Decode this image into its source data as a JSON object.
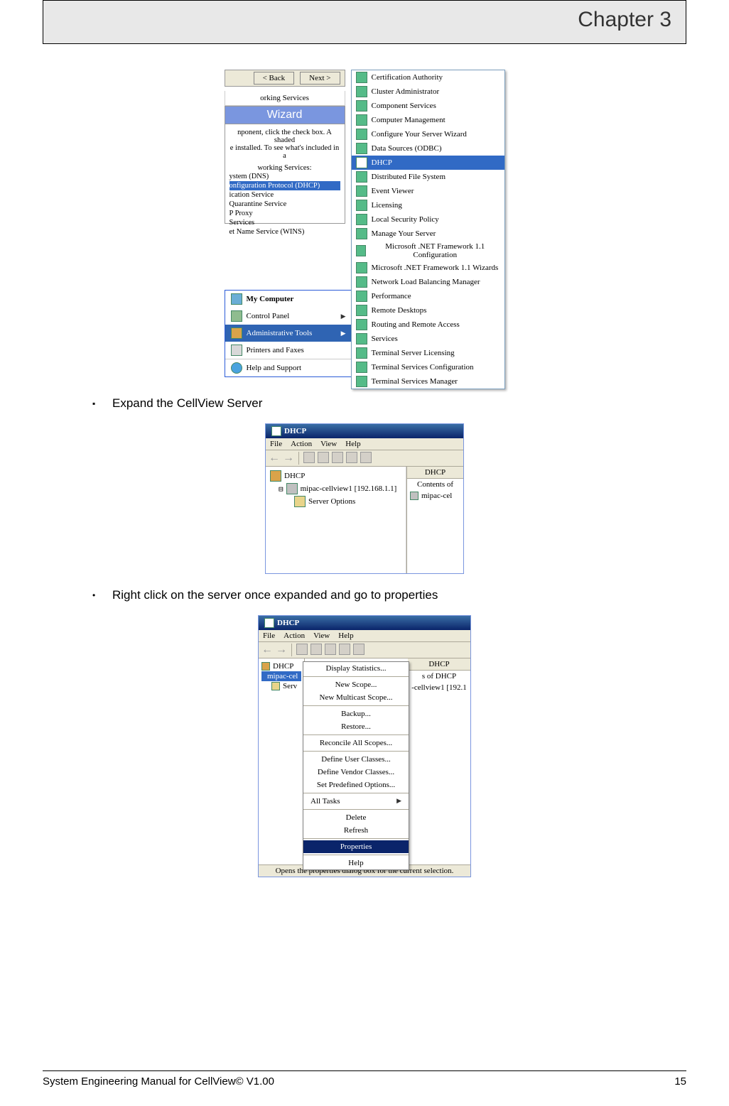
{
  "header": {
    "chapter": "Chapter 3"
  },
  "bullets": {
    "b1": "Expand the CellView Server",
    "b2": "Right click on the server once expanded and go to properties"
  },
  "fig1": {
    "back_btn": "< Back",
    "next_btn": "Next >",
    "wiz_title": "orking Services",
    "wiz_bar": "Wizard",
    "wiz_body1": "nponent, click the check box. A shaded",
    "wiz_body2": "e installed. To see what's included in a",
    "wiz_body3": "working Services:",
    "chk1": "ystem (DNS)",
    "chk2": "onfiguration Protocol (DHCP)",
    "chk3": "ication Service",
    "chk4": "Quarantine Service",
    "chk5": "P Proxy",
    "chk6": "Services",
    "chk7": "et Name Service (WINS)",
    "start": {
      "s1": "My Computer",
      "s2": "Control Panel",
      "s3": "Administrative Tools",
      "s4": "Printers and Faxes",
      "s5": "Help and Support"
    },
    "menu": {
      "m0": "Certification Authority",
      "m1": "Cluster Administrator",
      "m2": "Component Services",
      "m3": "Computer Management",
      "m4": "Configure Your Server Wizard",
      "m5": "Data Sources (ODBC)",
      "m6": "DHCP",
      "m7": "Distributed File System",
      "m8": "Event Viewer",
      "m9": "Licensing",
      "m10": "Local Security Policy",
      "m11": "Manage Your Server",
      "m12": "Microsoft .NET Framework 1.1 Configuration",
      "m13": "Microsoft .NET Framework 1.1 Wizards",
      "m14": "Network Load Balancing Manager",
      "m15": "Performance",
      "m16": "Remote Desktops",
      "m17": "Routing and Remote Access",
      "m18": "Services",
      "m19": "Terminal Server Licensing",
      "m20": "Terminal Services Configuration",
      "m21": "Terminal Services Manager"
    }
  },
  "fig2": {
    "title": "DHCP",
    "menus": {
      "file": "File",
      "action": "Action",
      "view": "View",
      "help": "Help"
    },
    "tree": {
      "root": "DHCP",
      "srv": "mipac-cellview1 [192.168.1.1]",
      "opt": "Server Options"
    },
    "right_h": "DHCP",
    "right_c1": "Contents of",
    "right_c2": "mipac-cel"
  },
  "fig3": {
    "title": "DHCP",
    "menus": {
      "file": "File",
      "action": "Action",
      "view": "View",
      "help": "Help"
    },
    "tree": {
      "root": "DHCP",
      "srv": "mipac-cel",
      "opt": "Serv"
    },
    "right_h": "DHCP",
    "right_c1": "s of DHCP",
    "right_c2": "-cellview1 [192.1",
    "ctx": {
      "c0": "Display Statistics...",
      "c1": "New Scope...",
      "c2": "New Multicast Scope...",
      "c3": "Backup...",
      "c4": "Restore...",
      "c5": "Reconcile All Scopes...",
      "c6": "Define User Classes...",
      "c7": "Define Vendor Classes...",
      "c8": "Set Predefined Options...",
      "c9": "All Tasks",
      "c10": "Delete",
      "c11": "Refresh",
      "c12": "Properties",
      "c13": "Help"
    },
    "status": "Opens the properties dialog box for the current selection."
  },
  "footer": {
    "left": "System Engineering Manual for CellView© V1.00",
    "right": "15"
  }
}
